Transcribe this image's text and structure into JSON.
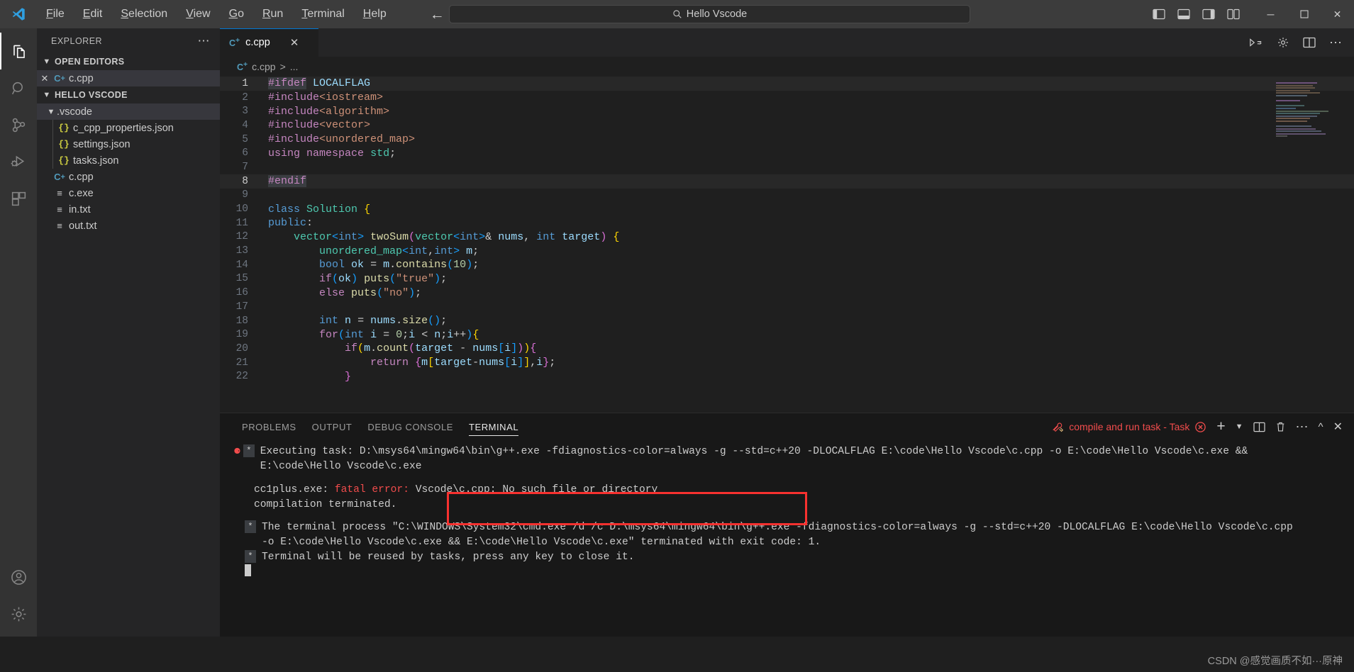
{
  "titlebar": {
    "logo_icon": "vscode-logo-icon",
    "menu": [
      {
        "label": "File",
        "mnemonic": "F"
      },
      {
        "label": "Edit",
        "mnemonic": "E"
      },
      {
        "label": "Selection",
        "mnemonic": "S"
      },
      {
        "label": "View",
        "mnemonic": "V"
      },
      {
        "label": "Go",
        "mnemonic": "G"
      },
      {
        "label": "Run",
        "mnemonic": "R"
      },
      {
        "label": "Terminal",
        "mnemonic": "T"
      },
      {
        "label": "Help",
        "mnemonic": "H"
      }
    ],
    "back_icon": "arrow-left-icon",
    "forward_icon": "arrow-right-icon",
    "command_center": {
      "search_icon": "search-icon",
      "value": "Hello Vscode"
    },
    "layout_icons": [
      "toggle-primary-sidebar-icon",
      "toggle-panel-icon",
      "toggle-secondary-sidebar-icon",
      "customize-layout-icon"
    ],
    "window_controls": {
      "minimize": "─",
      "maximize": "☐",
      "close": "✕"
    }
  },
  "activitybar": {
    "items": [
      {
        "name": "explorer",
        "icon": "files-icon",
        "active": true
      },
      {
        "name": "search",
        "icon": "search-icon",
        "active": false
      },
      {
        "name": "source-control",
        "icon": "source-control-icon",
        "active": false
      },
      {
        "name": "run-and-debug",
        "icon": "run-debug-icon",
        "active": false
      },
      {
        "name": "extensions",
        "icon": "extensions-icon",
        "active": false
      }
    ],
    "account_icon": "account-icon",
    "settings_icon": "gear-icon"
  },
  "sidebar": {
    "title": "EXPLORER",
    "more_actions_icon": "ellipsis-icon",
    "sections": [
      {
        "title": "OPEN EDITORS",
        "expanded": true,
        "items": [
          {
            "label": "c.cpp",
            "icon": "cpp-file-icon",
            "close_icon": "close-icon",
            "selected": true
          }
        ]
      },
      {
        "title": "HELLO VSCODE",
        "expanded": true,
        "items": [
          {
            "label": ".vscode",
            "icon": "folder-icon",
            "type": "folder",
            "expanded": true,
            "selected": true
          },
          {
            "label": "c_cpp_properties.json",
            "icon": "json-file-icon",
            "type": "file"
          },
          {
            "label": "settings.json",
            "icon": "json-file-icon",
            "type": "file"
          },
          {
            "label": "tasks.json",
            "icon": "json-file-icon",
            "type": "file"
          },
          {
            "label": "c.cpp",
            "icon": "cpp-file-icon",
            "type": "file"
          },
          {
            "label": "c.exe",
            "icon": "binary-file-icon",
            "type": "file"
          },
          {
            "label": "in.txt",
            "icon": "text-file-icon",
            "type": "file"
          },
          {
            "label": "out.txt",
            "icon": "text-file-icon",
            "type": "file"
          }
        ]
      }
    ]
  },
  "editor": {
    "tab": {
      "label": "c.cpp",
      "icon": "cpp-file-icon",
      "close_icon": "close-icon"
    },
    "tab_actions": [
      "run-code-icon",
      "split-editor-icon",
      "more-actions-icon",
      "settings-gear-icon"
    ],
    "breadcrumb": {
      "file": "c.cpp",
      "separator": ">",
      "rest": "..."
    },
    "lines": [
      {
        "n": "1",
        "highlight": true
      },
      {
        "n": "2",
        "highlight": false
      },
      {
        "n": "3",
        "highlight": false
      },
      {
        "n": "4",
        "highlight": false
      },
      {
        "n": "5",
        "highlight": false
      },
      {
        "n": "6",
        "highlight": false
      },
      {
        "n": "7",
        "highlight": false
      },
      {
        "n": "8",
        "highlight": true
      },
      {
        "n": "9",
        "highlight": false
      },
      {
        "n": "10",
        "highlight": false
      },
      {
        "n": "11",
        "highlight": false
      },
      {
        "n": "12",
        "highlight": false
      },
      {
        "n": "13",
        "highlight": false
      },
      {
        "n": "14",
        "highlight": false
      },
      {
        "n": "15",
        "highlight": false
      },
      {
        "n": "16",
        "highlight": false
      },
      {
        "n": "17",
        "highlight": false
      },
      {
        "n": "18",
        "highlight": false
      },
      {
        "n": "19",
        "highlight": false
      },
      {
        "n": "20",
        "highlight": false
      },
      {
        "n": "21",
        "highlight": false
      },
      {
        "n": "22",
        "highlight": false
      }
    ],
    "source_text": [
      "#ifdef LOCALFLAG",
      "#include<iostream>",
      "#include<algorithm>",
      "#include<vector>",
      "#include<unordered_map>",
      "using namespace std;",
      "",
      "#endif",
      "",
      "class Solution {",
      "public:",
      "    vector<int> twoSum(vector<int>& nums, int target) {",
      "        unordered_map<int,int> m;",
      "        bool ok = m.contains(10);",
      "        if(ok) puts(\"true\");",
      "        else puts(\"no\");",
      "",
      "        int n = nums.size();",
      "        for(int i = 0;i < n;i++){",
      "            if(m.count(target - nums[i])){",
      "                return {m[target-nums[i]],i};",
      "            }"
    ]
  },
  "panel": {
    "tabs": [
      {
        "label": "PROBLEMS",
        "active": false
      },
      {
        "label": "OUTPUT",
        "active": false
      },
      {
        "label": "DEBUG CONSOLE",
        "active": false
      },
      {
        "label": "TERMINAL",
        "active": true
      }
    ],
    "task": {
      "icon": "tools-icon",
      "label": "compile and run task - Task",
      "status_icon": "error-circle-icon"
    },
    "actions": [
      "new-terminal-icon",
      "chevron-down-icon",
      "split-terminal-icon",
      "kill-terminal-icon",
      "views-and-more-icon",
      "maximize-panel-icon",
      "close-panel-icon"
    ],
    "terminal_lines": [
      {
        "type": "task-start",
        "marker": "error-dot",
        "text": "Executing task: D:\\msys64\\mingw64\\bin\\g++.exe -fdiagnostics-color=always -g --std=c++20 -DLOCALFLAG E:\\code\\Hello Vscode\\c.cpp -o E:\\code\\Hello Vscode\\c.exe && E:\\code\\Hello Vscode\\c.exe"
      },
      {
        "type": "error",
        "prefix": "cc1plus.exe: ",
        "error_label": "fatal error: ",
        "text": "Vscode\\c.cpp: No such file or directory"
      },
      {
        "type": "error-cont",
        "text": "compilation terminated."
      },
      {
        "type": "info",
        "text": "The terminal process \"C:\\WINDOWS\\System32\\cmd.exe /d /c D:\\msys64\\mingw64\\bin\\g++.exe -fdiagnostics-color=always -g --std=c++20 -DLOCALFLAG E:\\code\\Hello Vscode\\c.cpp -o E:\\code\\Hello Vscode\\c.exe && E:\\code\\Hello Vscode\\c.exe\" terminated with exit code: 1."
      },
      {
        "type": "info",
        "text": "Terminal will be reused by tasks, press any key to close it."
      }
    ],
    "error_box_color": "#f8312f"
  },
  "watermark": "CSDN @感觉画质不如···原神",
  "colors": {
    "accent": "#0078d4",
    "error": "#f14c4c",
    "titlebar_bg": "#3c3c3c",
    "sidebar_bg": "#252526",
    "editor_bg": "#1f1f1f",
    "panel_bg": "#181818"
  }
}
